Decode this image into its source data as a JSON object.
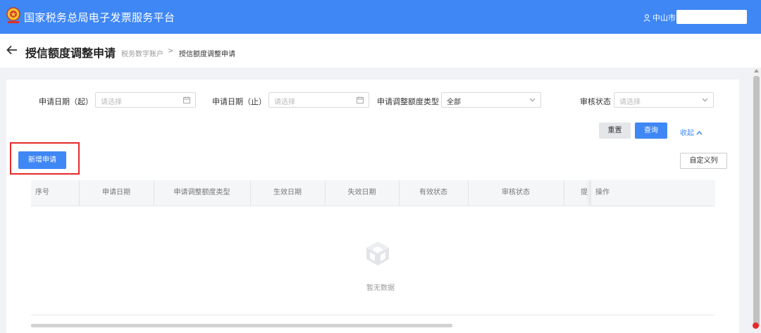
{
  "header": {
    "title": "国家税务总局电子发票服务平台",
    "user_label": "中山市",
    "brand_color": "#3f87f5"
  },
  "page": {
    "title": "授信额度调整申请",
    "breadcrumb": [
      "税务数字账户",
      "授信额度调整申请"
    ],
    "breadcrumb_separator": ">"
  },
  "filters": {
    "start_date_label": "申请日期（起）",
    "start_date_placeholder": "请选择",
    "end_date_label": "申请日期（止）",
    "end_date_placeholder": "请选择",
    "type_label": "申请调整额度类型",
    "type_value": "全部",
    "status_label": "审核状态",
    "status_placeholder": "请选择"
  },
  "actions": {
    "reset_label": "重置",
    "query_label": "查询",
    "collapse_label": "收起",
    "add_label": "新增申请",
    "custom_columns_label": "自定义列",
    "highlight_color": "#e52a2a"
  },
  "table": {
    "columns": [
      "序号",
      "申请日期",
      "申请调整额度类型",
      "生效日期",
      "失效日期",
      "有效状态",
      "审核状态",
      "操作"
    ],
    "clipped_column_glyph": "提",
    "rows": [],
    "empty_text": "暂无数据"
  }
}
